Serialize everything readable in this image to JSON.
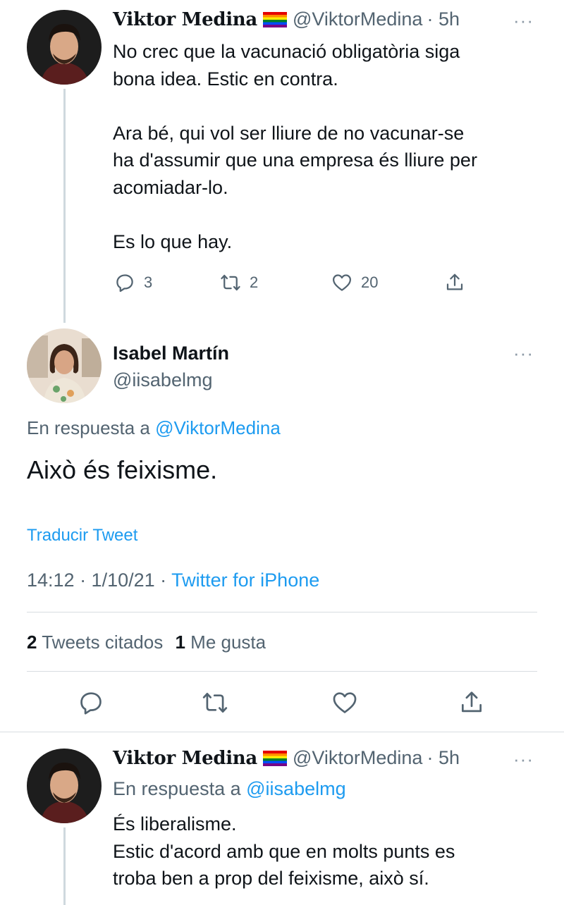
{
  "tweet1": {
    "display_name": "Viktor Medina",
    "handle": "@ViktorMedina",
    "time": "· 5h",
    "more": "···",
    "text": "No crec que la vacunació obligatòria siga\nbona idea. Estic en contra.\n\nAra bé, qui vol ser lliure de no vacunar-se\nha d'assumir que una empresa és lliure per\nacomiadar-lo.\n\nEs lo que hay.",
    "replies": "3",
    "retweets": "2",
    "likes": "20"
  },
  "main_tweet": {
    "display_name": "Isabel Martín",
    "handle": "@iisabelmg",
    "more": "···",
    "reply_prefix": "En respuesta a",
    "reply_to": "@ViktorMedina",
    "text": "Això és feixisme.",
    "translate": "Traducir Tweet",
    "timestamp": "14:12 · 1/10/21 · ",
    "source": "Twitter for iPhone",
    "quote_count": "2",
    "quote_label": "Tweets citados",
    "like_count": "1",
    "like_label": "Me gusta"
  },
  "tweet3": {
    "display_name": "Viktor Medina",
    "handle": "@ViktorMedina",
    "time": "· 5h",
    "more": "···",
    "reply_prefix": "En respuesta a",
    "reply_to": "@iisabelmg",
    "text": "És liberalisme.\nEstic d'acord amb que en molts punts es\ntroba ben a prop del feixisme, això sí."
  },
  "colors": {
    "link": "#1d9bf0",
    "muted": "#536471",
    "divider": "#d8dde1"
  },
  "icons": [
    "reply-icon",
    "retweet-icon",
    "like-icon",
    "share-icon",
    "more-icon",
    "rainbow-flag-icon"
  ]
}
